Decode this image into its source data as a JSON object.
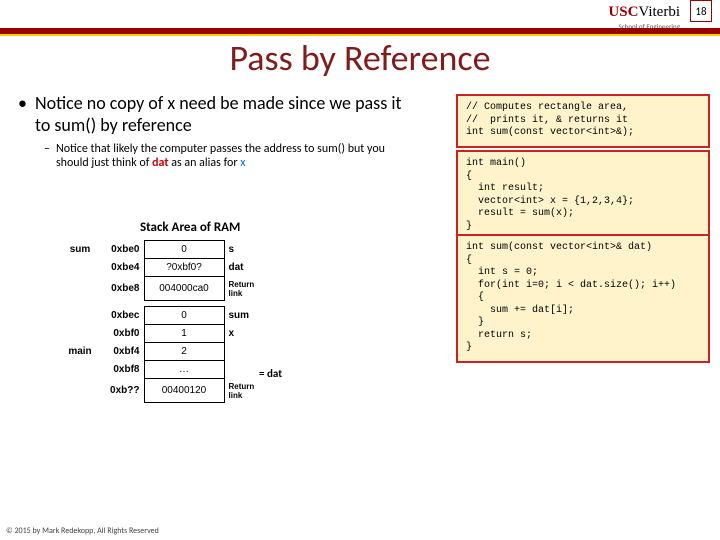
{
  "page_number": "18",
  "logo": {
    "usc": "USC",
    "viterbi": "Viterbi",
    "sub": "School of Engineering"
  },
  "title": "Pass by Reference",
  "bullet1": "Notice no copy of x need be made since we pass it to sum() by reference",
  "bullet2_pre": "Notice that likely the computer passes the address to sum() but you should just think of ",
  "bullet2_dat": "dat",
  "bullet2_mid": " as an alias for ",
  "bullet2_x": "x",
  "stack_title": "Stack Area of RAM",
  "rows1": [
    {
      "lab": "sum",
      "addr": "0xbe0",
      "val": "0",
      "var": "s"
    },
    {
      "lab": "",
      "addr": "0xbe4",
      "val": "?0xbf0?",
      "var": "dat"
    },
    {
      "lab": "",
      "addr": "0xbe8",
      "val": "004000ca0",
      "var": "Return link",
      "ret": true
    }
  ],
  "rows2": [
    {
      "lab": "",
      "addr": "0xbec",
      "val": "0",
      "var": "sum"
    },
    {
      "lab": "",
      "addr": "0xbf0",
      "val": "1",
      "var": "x"
    },
    {
      "lab": "main",
      "addr": "0xbf4",
      "val": "2",
      "var": ""
    },
    {
      "lab": "",
      "addr": "0xbf8",
      "val": "…",
      "var": ""
    },
    {
      "lab": "",
      "addr": "0xb??",
      "val": "00400120",
      "var": "Return link",
      "ret": true
    }
  ],
  "eq_dat": "= dat",
  "code1": "// Computes rectangle area,\n//  prints it, & returns it\nint sum(const vector<int>&);",
  "code2": "int main()\n{\n  int result;\n  vector<int> x = {1,2,3,4};\n  result = sum(x);\n}",
  "code3": "int sum(const vector<int>& dat)\n{\n  int s = 0;\n  for(int i=0; i < dat.size(); i++)\n  {\n    sum += dat[i];\n  }\n  return s;\n}",
  "copyright": "© 2015 by Mark Redekopp, All Rights Reserved"
}
